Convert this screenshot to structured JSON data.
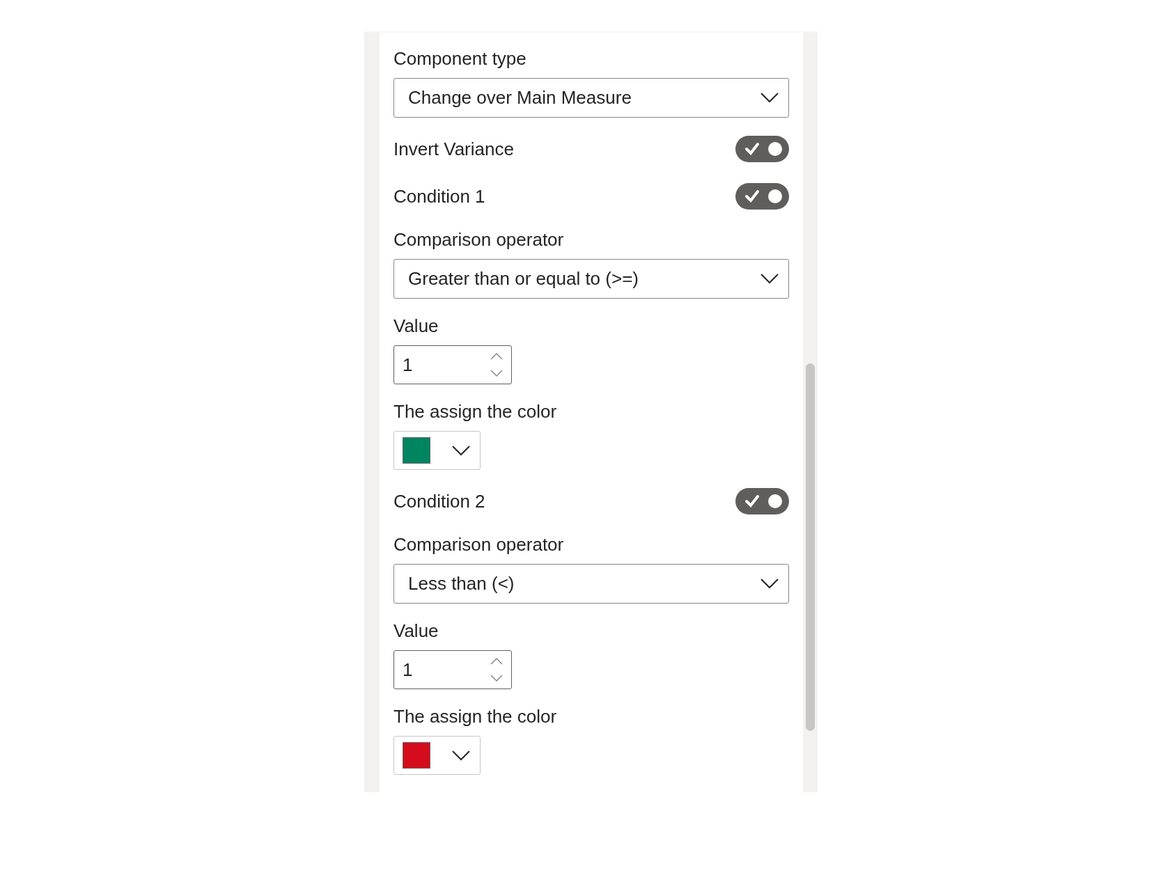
{
  "fields": [
    {
      "kind": "dropdown",
      "label": "Component type",
      "value": "Change over Main Measure"
    },
    {
      "kind": "toggle",
      "label": "Invert Variance",
      "on": true
    },
    {
      "kind": "toggle",
      "label": "Condition 1",
      "on": true
    },
    {
      "kind": "dropdown",
      "label": "Comparison operator",
      "value": "Greater than or equal to (>=)"
    },
    {
      "kind": "number",
      "label": "Value",
      "value": "1"
    },
    {
      "kind": "color",
      "label": "The assign the color",
      "color": "#008561"
    },
    {
      "kind": "toggle",
      "label": "Condition 2",
      "on": true
    },
    {
      "kind": "dropdown",
      "label": "Comparison operator",
      "value": "Less than (<)"
    },
    {
      "kind": "number",
      "label": "Value",
      "value": "1"
    },
    {
      "kind": "color",
      "label": "The assign the color",
      "color": "#d40c1c"
    }
  ]
}
